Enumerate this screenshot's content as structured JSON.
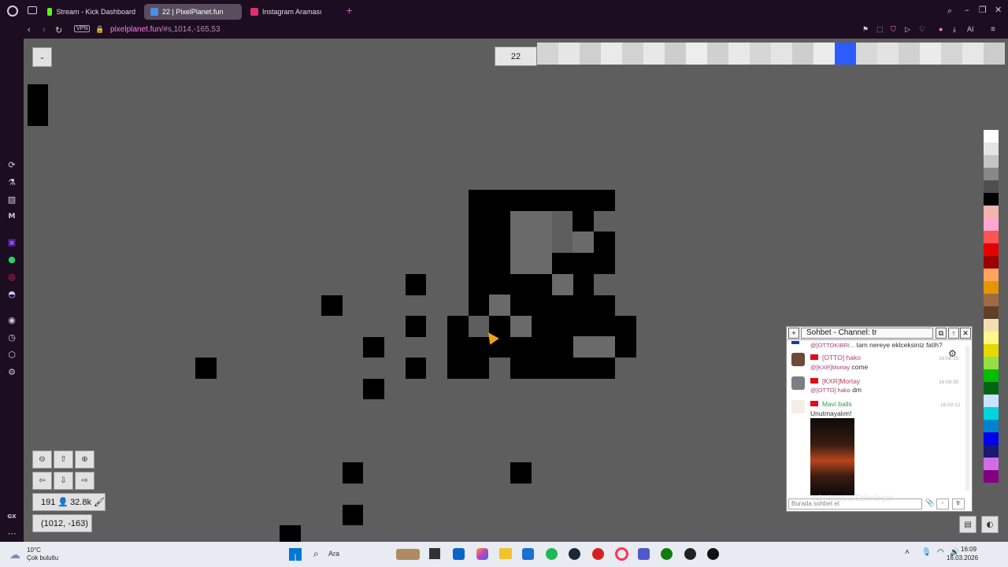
{
  "browser": {
    "tabs": [
      {
        "label": "Stream - Kick Dashboard",
        "icon": "kick-icon",
        "color": "#53fc18"
      },
      {
        "label": "22 | PixelPlanet.fun",
        "icon": "pixelplanet-icon",
        "color": "#4a90e2"
      },
      {
        "label": "Instagram Araması",
        "icon": "instagram-icon",
        "color": "#e1306c"
      }
    ],
    "address": {
      "host": "pixelplanet.fun",
      "path": "/#s,1014,-165,53"
    },
    "vpn_label": "VPN",
    "ai_label": "AI",
    "gx_label": "GX"
  },
  "game": {
    "cooldown": "22",
    "online_count": "191",
    "pixel_count": "32.8k",
    "coordinates": "(1012, -163)"
  },
  "chat": {
    "title": "Sohbet - Channel: tr",
    "input_placeholder": "Burada sohbet et",
    "lang_button": "tr",
    "messages": [
      {
        "name": "",
        "text": "tam nereye eklceksiniz fatih?",
        "mention": "@[OTTOKIBRI...",
        "time": ""
      },
      {
        "name": "[OTTO] hako",
        "mention": "@[KXR]Mortay",
        "text": "come",
        "time": "16:08:25"
      },
      {
        "name": "[KXR]Mortay",
        "mention": "@[OTTO] hako",
        "text": "dm",
        "time": "16:08:30"
      },
      {
        "name": "Mavi balls",
        "mention": "",
        "text": "Unutmayalım!",
        "time": "16:09:12"
      }
    ]
  },
  "taskbar": {
    "weather_temp": "10°C",
    "weather_desc": "Çok bulutlu",
    "search_label": "Ara",
    "clock_time": "16:09",
    "clock_date": "16.03.2026"
  },
  "watermark": "Windows'u Etkinleştir",
  "palette_colors": [
    "#ffffff",
    "#e4e4e4",
    "#c4c4c4",
    "#888888",
    "#4e4e4e",
    "#000000",
    "#f4b3ae",
    "#ffa7d1",
    "#ff5454",
    "#e50000",
    "#9a0000",
    "#fea460",
    "#e59500",
    "#a06a42",
    "#604028",
    "#f5dfb0",
    "#fff889",
    "#e5d900",
    "#94e044",
    "#02be01",
    "#006513",
    "#cae3ff",
    "#00d3dd",
    "#0083c7",
    "#0000ea",
    "#191973",
    "#cf6ee4",
    "#820080"
  ],
  "history_colors": [
    "#d4d4d4",
    "#e6e6e6",
    "#cfcfcf",
    "#eaeaea",
    "#d2d2d2",
    "#e8e8e8",
    "#cdcdcd",
    "#ededed",
    "#d0d0d0",
    "#e9e9e9",
    "#d6d6d6",
    "#e4e4e4",
    "#cecece",
    "#ececec",
    "#2b5cff",
    "#d8d8d8",
    "#e3e3e3",
    "#d1d1d1",
    "#ebebeb",
    "#d5d5d5",
    "#e7e7e7",
    "#cccccc"
  ]
}
